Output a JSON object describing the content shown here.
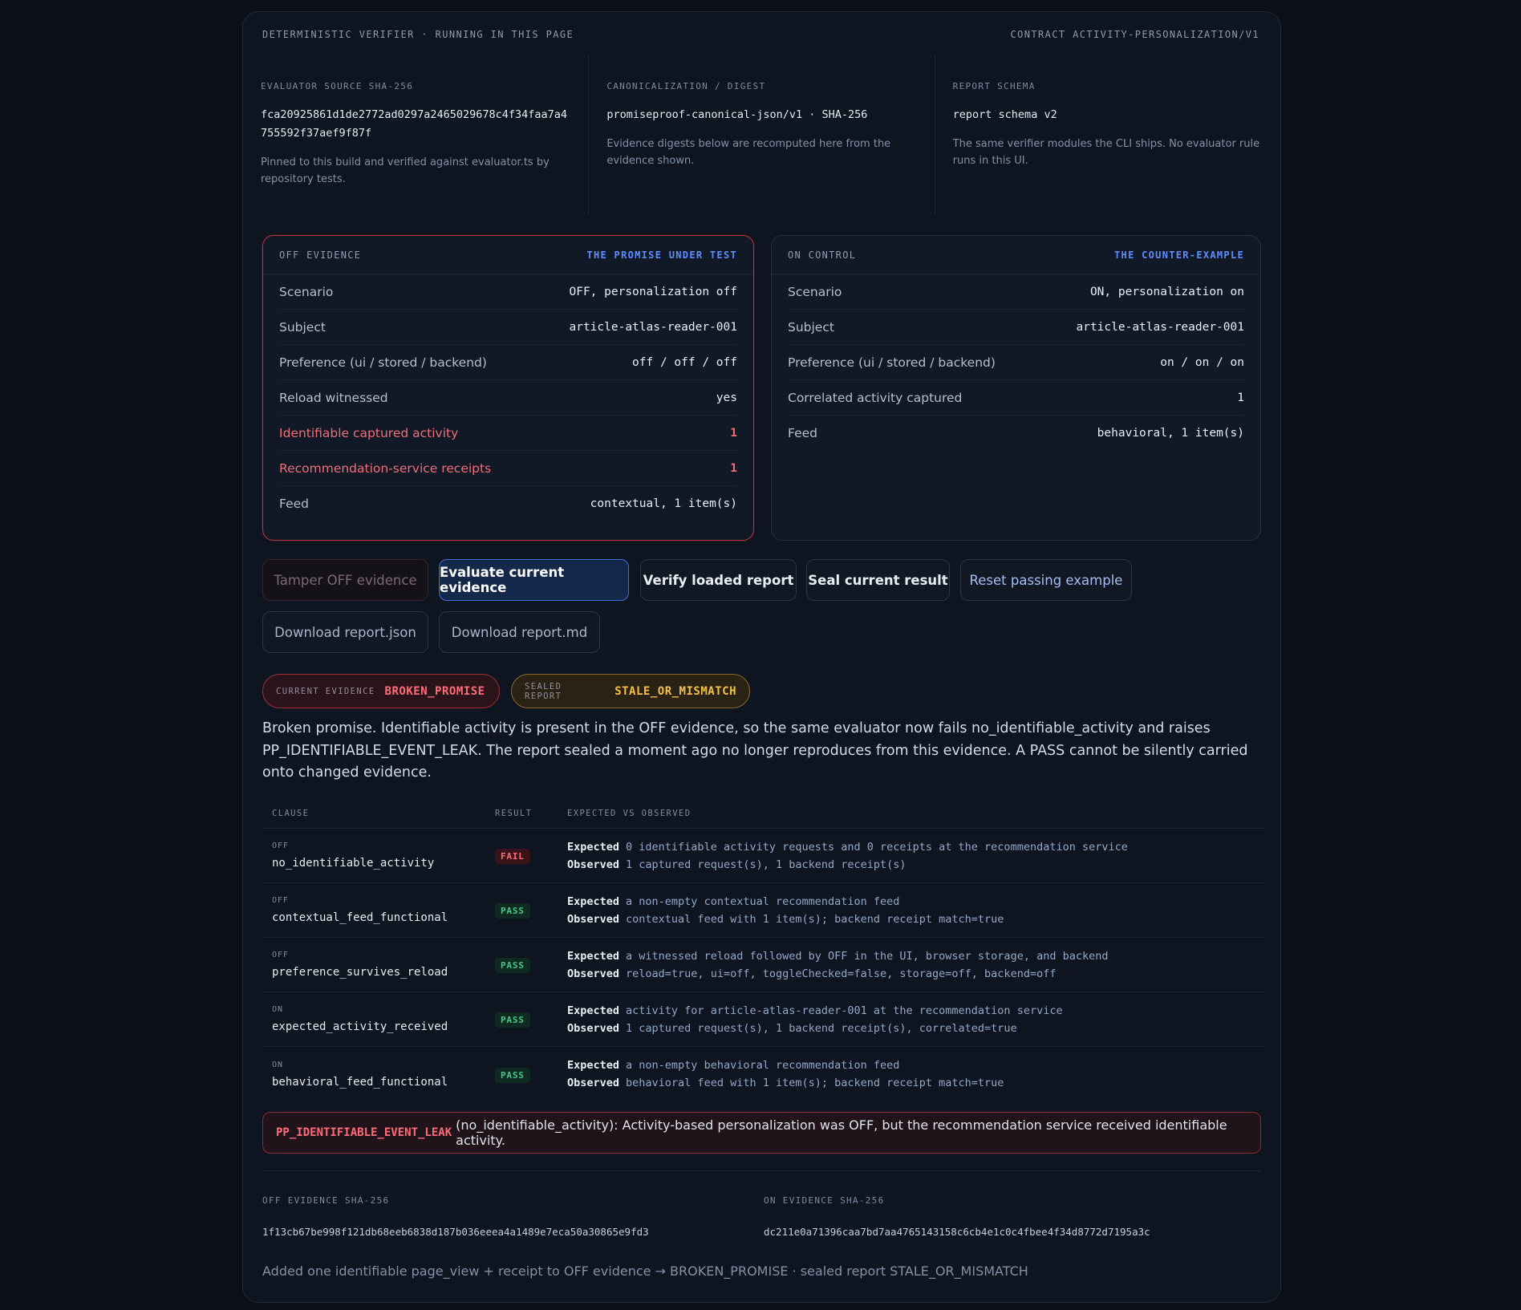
{
  "topbar": {
    "left": "DETERMINISTIC VERIFIER · RUNNING IN THIS PAGE",
    "right": "CONTRACT ACTIVITY-PERSONALIZATION/V1"
  },
  "meta": [
    {
      "label": "EVALUATOR SOURCE SHA-256",
      "value": "fca20925861d1de2772ad0297a2465029678c4f34faa7a4755592f37aef9f87f",
      "note": "Pinned to this build and verified against evaluator.ts by repository tests."
    },
    {
      "label": "CANONICALIZATION / DIGEST",
      "value": "promiseproof-canonical-json/v1 · SHA-256",
      "note": "Evidence digests below are recomputed here from the evidence shown."
    },
    {
      "label": "REPORT SCHEMA",
      "value": "report schema v2",
      "note": "The same verifier modules the CLI ships. No evaluator rule runs in this UI."
    }
  ],
  "off_card": {
    "title": "OFF EVIDENCE",
    "tag": "THE PROMISE UNDER TEST",
    "rows": [
      {
        "k": "Scenario",
        "v": "OFF, personalization off"
      },
      {
        "k": "Subject",
        "v": "article-atlas-reader-001"
      },
      {
        "k": "Preference (ui / stored / backend)",
        "v": "off / off / off"
      },
      {
        "k": "Reload witnessed",
        "v": "yes"
      },
      {
        "k": "Identifiable captured activity",
        "v": "1"
      },
      {
        "k": "Recommendation-service receipts",
        "v": "1"
      },
      {
        "k": "Feed",
        "v": "contextual, 1 item(s)"
      }
    ]
  },
  "on_card": {
    "title": "ON CONTROL",
    "tag": "THE COUNTER-EXAMPLE",
    "rows": [
      {
        "k": "Scenario",
        "v": "ON, personalization on"
      },
      {
        "k": "Subject",
        "v": "article-atlas-reader-001"
      },
      {
        "k": "Preference (ui / stored / backend)",
        "v": "on / on / on"
      },
      {
        "k": "Correlated activity captured",
        "v": "1"
      },
      {
        "k": "Feed",
        "v": "behavioral, 1 item(s)"
      }
    ]
  },
  "buttons": {
    "tamper": "Tamper OFF evidence",
    "evaluate": "Evaluate current evidence",
    "verify": "Verify loaded report",
    "seal": "Seal current result",
    "reset": "Reset passing example",
    "dl_json": "Download report.json",
    "dl_md": "Download report.md"
  },
  "badges": {
    "current_label": "CURRENT EVIDENCE",
    "current_value": "BROKEN_PROMISE",
    "sealed_label": "SEALED REPORT",
    "sealed_value": "STALE_OR_MISMATCH"
  },
  "summary": "Broken promise. Identifiable activity is present in the OFF evidence, so the same evaluator now fails no_identifiable_activity and raises PP_IDENTIFIABLE_EVENT_LEAK. The report sealed a moment ago no longer reproduces from this evidence. A PASS cannot be silently carried onto changed evidence.",
  "table": {
    "headers": {
      "clause": "CLAUSE",
      "result": "RESULT",
      "eo": "EXPECTED VS OBSERVED"
    },
    "expected_label": "Expected",
    "observed_label": "Observed",
    "rows": [
      {
        "side": "OFF",
        "clause": "no_identifiable_activity",
        "result": "FAIL",
        "expected": "0 identifiable activity requests and 0 receipts at the recommendation service",
        "observed": "1 captured request(s), 1 backend receipt(s)"
      },
      {
        "side": "OFF",
        "clause": "contextual_feed_functional",
        "result": "PASS",
        "expected": "a non-empty contextual recommendation feed",
        "observed": "contextual feed with 1 item(s); backend receipt match=true"
      },
      {
        "side": "OFF",
        "clause": "preference_survives_reload",
        "result": "PASS",
        "expected": "a witnessed reload followed by OFF in the UI, browser storage, and backend",
        "observed": "reload=true, ui=off, toggleChecked=false, storage=off, backend=off"
      },
      {
        "side": "ON",
        "clause": "expected_activity_received",
        "result": "PASS",
        "expected": "activity for article-atlas-reader-001 at the recommendation service",
        "observed": "1 captured request(s), 1 backend receipt(s), correlated=true"
      },
      {
        "side": "ON",
        "clause": "behavioral_feed_functional",
        "result": "PASS",
        "expected": "a non-empty behavioral recommendation feed",
        "observed": "behavioral feed with 1 item(s); backend receipt match=true"
      }
    ]
  },
  "alert": {
    "code": "PP_IDENTIFIABLE_EVENT_LEAK",
    "text": "(no_identifiable_activity): Activity-based personalization was OFF, but the recommendation service received identifiable activity."
  },
  "digests": {
    "off_label": "OFF EVIDENCE SHA-256",
    "off_value": "1f13cb67be998f121db68eeb6838d187b036eeea4a1489e7eca50a30865e9fd3",
    "on_label": "ON EVIDENCE SHA-256",
    "on_value": "dc211e0a71396caa7bd7aa4765143158c6cb4e1c0c4fbee4f34d8772d7195a3c"
  },
  "footer": "Added one identifiable page_view + receipt to OFF evidence → BROKEN_PROMISE · sealed report STALE_OR_MISMATCH",
  "colors": {
    "background": "#0b1018",
    "panel": "#0e1521",
    "fail": "#ff6b78",
    "pass": "#43c98a",
    "warn": "#f5c04a",
    "accent": "#5f8dff"
  }
}
